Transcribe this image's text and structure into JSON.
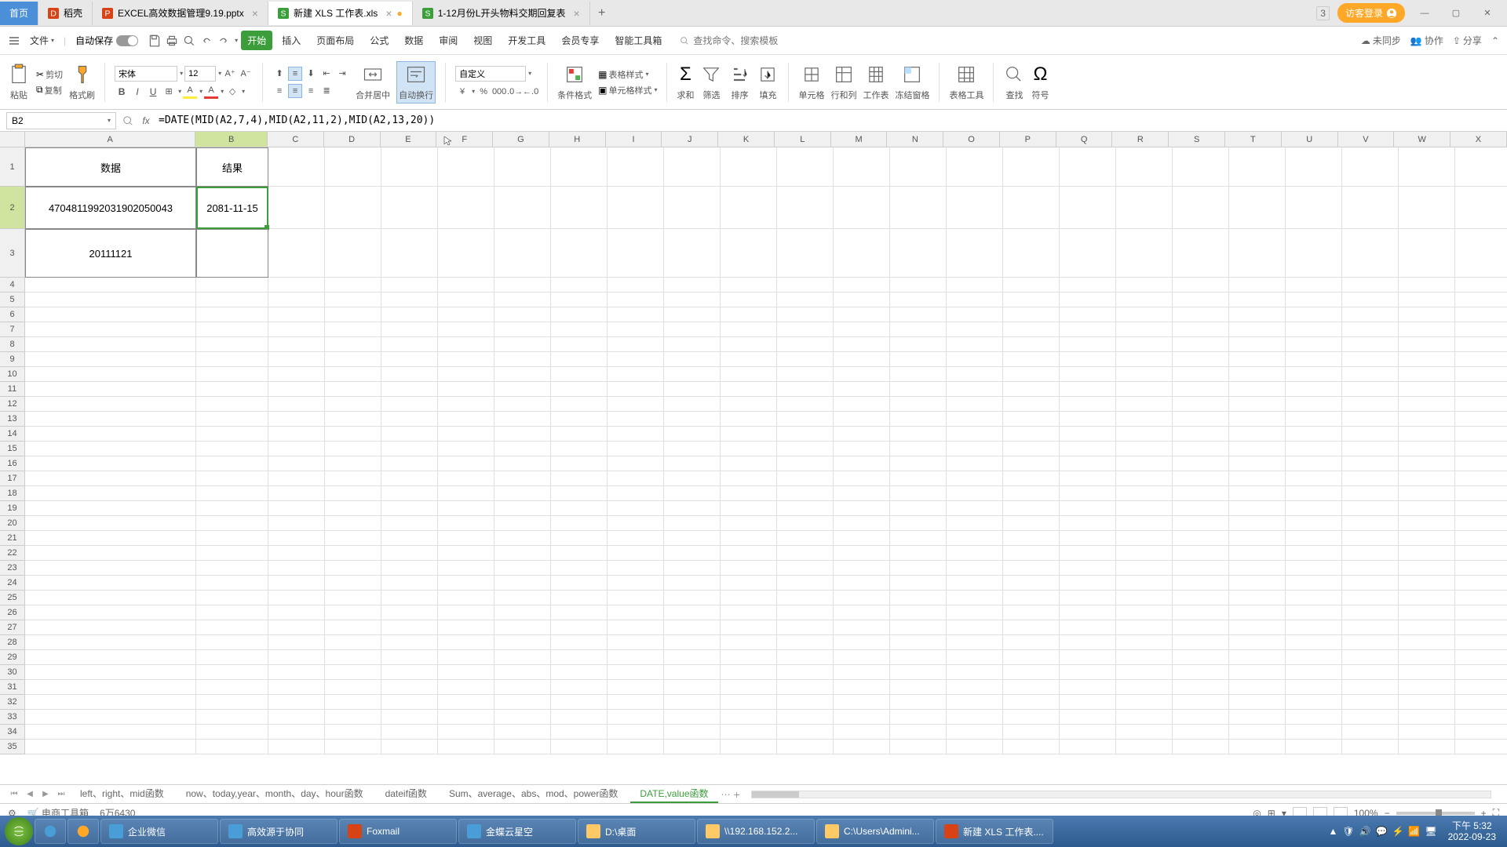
{
  "tabs": {
    "home": "首页",
    "items": [
      {
        "label": "稻壳",
        "icon_color": "#d84315"
      },
      {
        "label": "EXCEL高效数据管理9.19.pptx",
        "icon_color": "#d84315"
      },
      {
        "label": "新建 XLS 工作表.xls",
        "icon_color": "#3b9e3b",
        "active": true,
        "dirty": true
      },
      {
        "label": "1-12月份L开头物料交期回复表",
        "icon_color": "#3b9e3b"
      }
    ],
    "login": "访客登录",
    "badge_num": "3"
  },
  "menu": {
    "file": "文件",
    "auto_save": "自动保存",
    "items": [
      "开始",
      "插入",
      "页面布局",
      "公式",
      "数据",
      "审阅",
      "视图",
      "开发工具",
      "会员专享",
      "智能工具箱"
    ],
    "search_placeholder": "查找命令、搜索模板",
    "no_sync": "未同步",
    "coop": "协作",
    "share": "分享"
  },
  "ribbon": {
    "paste": "粘贴",
    "cut": "剪切",
    "copy": "复制",
    "format_painter": "格式刷",
    "font_name": "宋体",
    "font_size": "12",
    "merge": "合并居中",
    "wrap": "自动换行",
    "num_format": "自定义",
    "cond_fmt": "条件格式",
    "table_style": "表格样式",
    "cell_style": "单元格样式",
    "sum": "求和",
    "filter": "筛选",
    "sort": "排序",
    "fill": "填充",
    "cell": "单元格",
    "rowcol": "行和列",
    "sheet": "工作表",
    "freeze": "冻结窗格",
    "table_tool": "表格工具",
    "find": "查找",
    "symbol": "符号"
  },
  "formula": {
    "cell_ref": "B2",
    "formula": "=DATE(MID(A2,7,4),MID(A2,11,2),MID(A2,13,20))"
  },
  "columns": [
    "A",
    "B",
    "C",
    "D",
    "E",
    "F",
    "G",
    "H",
    "I",
    "J",
    "K",
    "L",
    "M",
    "N",
    "O",
    "P",
    "Q",
    "R",
    "S",
    "T",
    "U",
    "V",
    "W",
    "X"
  ],
  "col_widths": {
    "A": 218,
    "B": 92,
    "default": 72
  },
  "row_heights": {
    "1": 50,
    "2": 54,
    "3": 62,
    "default": 19
  },
  "cells": {
    "A1": "数据",
    "B1": "结果",
    "A2": "4704811992031902050043",
    "B2": "2081-11-15",
    "A3": "20111121"
  },
  "selected_cell": "B2",
  "sheet_tabs": {
    "items": [
      "left、right、mid函数",
      "now、today,year、month、day、hour函数",
      "dateif函数",
      "Sum、average、abs、mod、power函数",
      "DATE,value函数"
    ],
    "active_index": 4
  },
  "status": {
    "tool": "电商工具箱",
    "count": "6万6430",
    "zoom": "100%"
  },
  "taskbar": {
    "items": [
      {
        "label": "企业微信",
        "color": "#4a9ed8"
      },
      {
        "label": "高效源于协同",
        "color": "#4a9ed8"
      },
      {
        "label": "Foxmail",
        "color": "#d84315"
      },
      {
        "label": "金蝶云星空",
        "color": "#4a9ed8"
      },
      {
        "label": "D:\\桌面",
        "color": "#ffc966"
      },
      {
        "label": "\\\\192.168.152.2...",
        "color": "#ffc966"
      },
      {
        "label": "C:\\Users\\Admini...",
        "color": "#ffc966"
      },
      {
        "label": "新建 XLS 工作表....",
        "color": "#d84315"
      }
    ],
    "time": "下午 5:32",
    "date": "2022-09-23"
  }
}
